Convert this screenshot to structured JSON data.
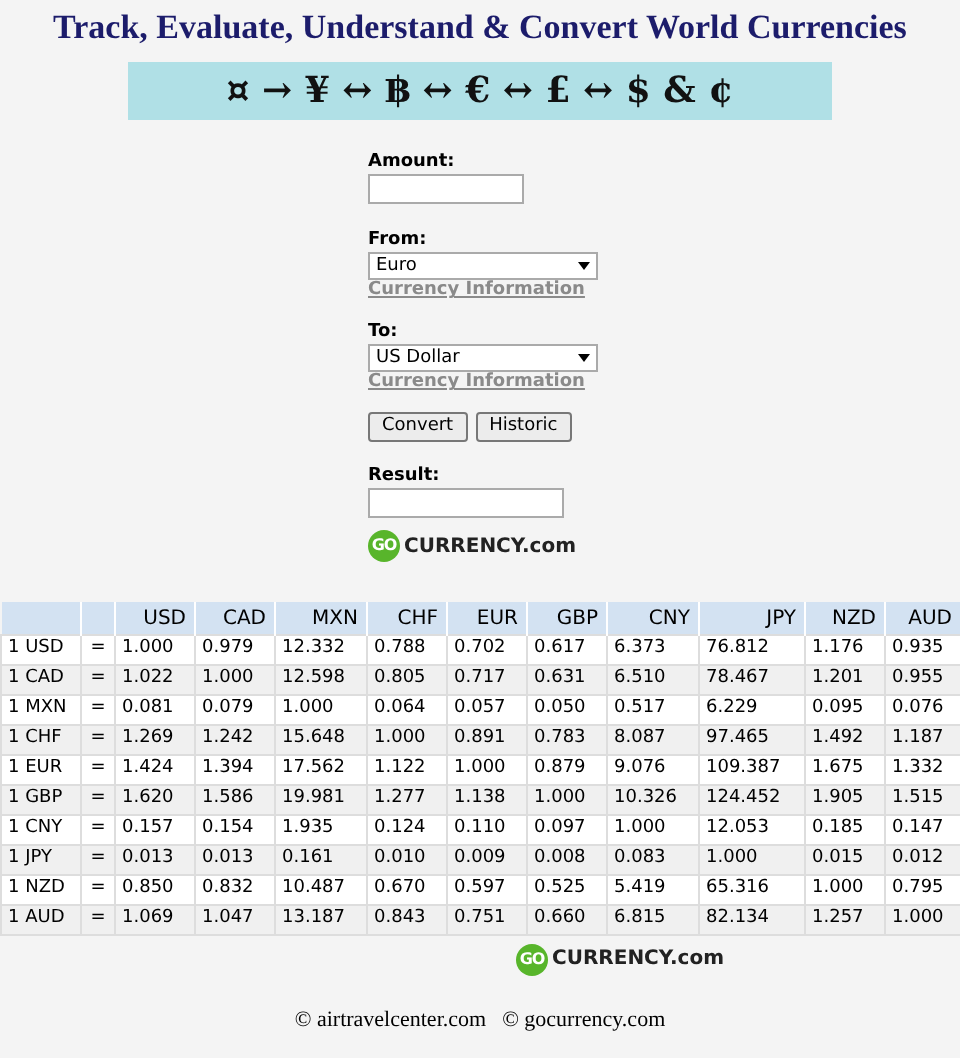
{
  "title": "Track, Evaluate, Understand & Convert World Currencies",
  "banner": "¤ → ¥ ↔ ฿ ↔ € ↔ £ ↔ $ & ¢",
  "form": {
    "amount_label": "Amount:",
    "from_label": "From:",
    "from_value": "Euro",
    "from_link": "Currency Information",
    "to_label": "To:",
    "to_value": "US Dollar",
    "to_link": "Currency Information",
    "buttons": [
      "Convert",
      "Historic"
    ],
    "result_label": "Result:"
  },
  "logo": {
    "badge": "GO",
    "text": "CURRENCY.com"
  },
  "table": {
    "columns": [
      "USD",
      "CAD",
      "MXN",
      "CHF",
      "EUR",
      "GBP",
      "CNY",
      "JPY",
      "NZD",
      "AUD"
    ],
    "rows": [
      {
        "label": "1 USD",
        "eq": "=",
        "values": [
          "1.000",
          "0.979",
          "12.332",
          "0.788",
          "0.702",
          "0.617",
          "6.373",
          "76.812",
          "1.176",
          "0.935"
        ]
      },
      {
        "label": "1 CAD",
        "eq": "=",
        "values": [
          "1.022",
          "1.000",
          "12.598",
          "0.805",
          "0.717",
          "0.631",
          "6.510",
          "78.467",
          "1.201",
          "0.955"
        ]
      },
      {
        "label": "1 MXN",
        "eq": "=",
        "values": [
          "0.081",
          "0.079",
          "1.000",
          "0.064",
          "0.057",
          "0.050",
          "0.517",
          "6.229",
          "0.095",
          "0.076"
        ]
      },
      {
        "label": "1 CHF",
        "eq": "=",
        "values": [
          "1.269",
          "1.242",
          "15.648",
          "1.000",
          "0.891",
          "0.783",
          "8.087",
          "97.465",
          "1.492",
          "1.187"
        ]
      },
      {
        "label": "1 EUR",
        "eq": "=",
        "values": [
          "1.424",
          "1.394",
          "17.562",
          "1.122",
          "1.000",
          "0.879",
          "9.076",
          "109.387",
          "1.675",
          "1.332"
        ]
      },
      {
        "label": "1 GBP",
        "eq": "=",
        "values": [
          "1.620",
          "1.586",
          "19.981",
          "1.277",
          "1.138",
          "1.000",
          "10.326",
          "124.452",
          "1.905",
          "1.515"
        ]
      },
      {
        "label": "1 CNY",
        "eq": "=",
        "values": [
          "0.157",
          "0.154",
          "1.935",
          "0.124",
          "0.110",
          "0.097",
          "1.000",
          "12.053",
          "0.185",
          "0.147"
        ]
      },
      {
        "label": "1 JPY",
        "eq": "=",
        "values": [
          "0.013",
          "0.013",
          "0.161",
          "0.010",
          "0.009",
          "0.008",
          "0.083",
          "1.000",
          "0.015",
          "0.012"
        ]
      },
      {
        "label": "1 NZD",
        "eq": "=",
        "values": [
          "0.850",
          "0.832",
          "10.487",
          "0.670",
          "0.597",
          "0.525",
          "5.419",
          "65.316",
          "1.000",
          "0.795"
        ]
      },
      {
        "label": "1 AUD",
        "eq": "=",
        "values": [
          "1.069",
          "1.047",
          "13.187",
          "0.843",
          "0.751",
          "0.660",
          "6.815",
          "82.134",
          "1.257",
          "1.000"
        ]
      }
    ]
  },
  "logo2": {
    "badge": "GO",
    "text": "CURRENCY.com"
  },
  "footer": [
    {
      "symbol": "©",
      "link": "airtravelcenter.com"
    },
    {
      "symbol": "©",
      "link": "gocurrency.com"
    }
  ]
}
